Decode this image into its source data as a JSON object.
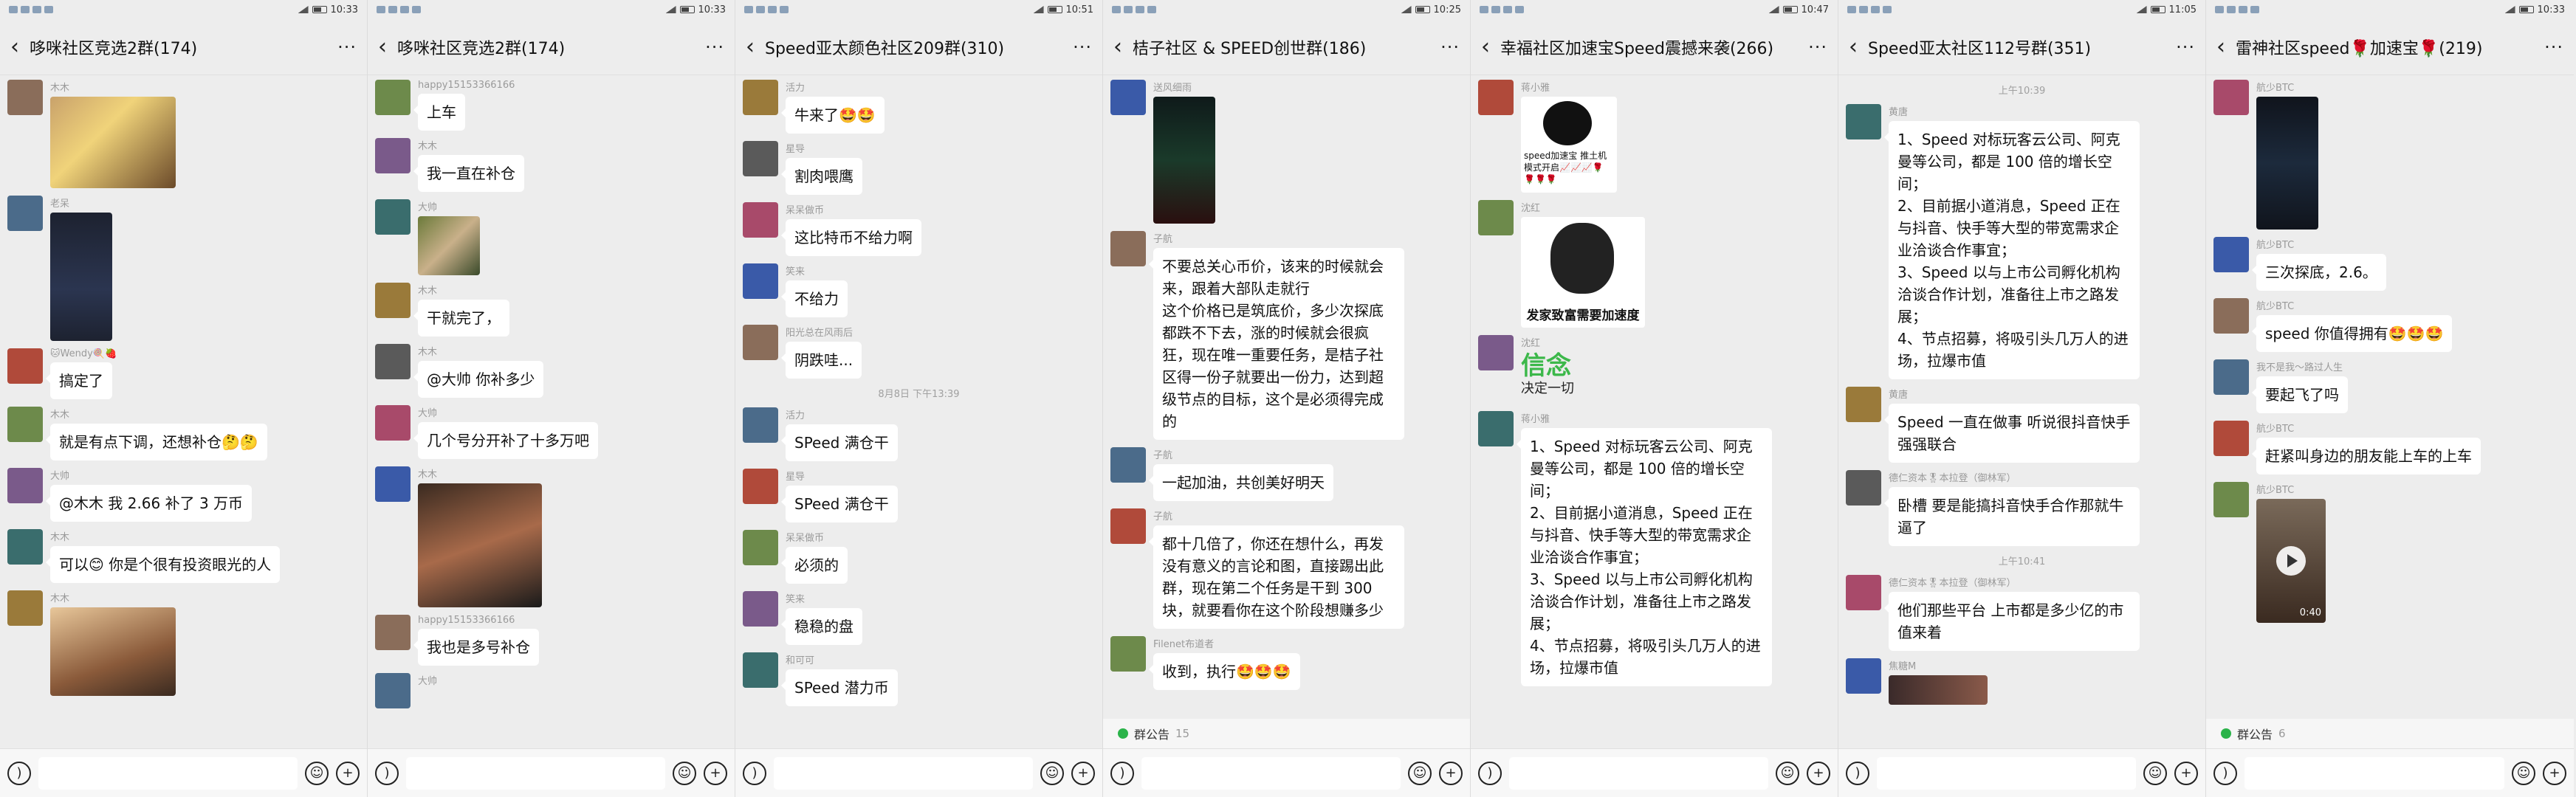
{
  "status": {
    "times": [
      "10:33",
      "10:33",
      "10:51",
      "10:25",
      "10:47",
      "11:05",
      "10:33"
    ]
  },
  "input": {
    "voice_icon": "voice-icon",
    "emoji_icon": "emoji-icon",
    "plus_icon": "plus-icon"
  },
  "colors": {
    "bg": "#ededed",
    "bubble": "#ffffff",
    "notice_dot": "#2bb34a"
  },
  "panels": [
    {
      "title": "哆咪社区竞选2群(174)",
      "messages": [
        {
          "sender": "木木",
          "image": "photo-child"
        },
        {
          "sender": "老呆",
          "image": "phone-screenshot"
        },
        {
          "sender": "🐱Wendy🍭🍓",
          "text": "搞定了"
        },
        {
          "sender": "木木",
          "text": "就是有点下调，还想补仓🤔🤔"
        },
        {
          "sender": "大帅",
          "text": "@木木  我 2.66 补了 3 万币"
        },
        {
          "sender": "木木",
          "text": "可以😊 你是个很有投资眼光的人"
        },
        {
          "sender": "木木",
          "image": "photo-man-smoking"
        }
      ]
    },
    {
      "title": "哆咪社区竞选2群(174)",
      "messages": [
        {
          "sender": "happy15153366166",
          "text": "上车"
        },
        {
          "sender": "木木",
          "text": "我一直在补仓"
        },
        {
          "sender": "大帅",
          "image": "photo-soldier"
        },
        {
          "sender": "木木",
          "text": "干就完了，"
        },
        {
          "sender": "木木",
          "text": "@大帅  你补多少"
        },
        {
          "sender": "大帅",
          "text": "几个号分开补了十多万吧"
        },
        {
          "sender": "木木",
          "image": "photo-woman"
        },
        {
          "sender": "happy15153366166",
          "text": "我也是多号补仓"
        },
        {
          "sender": "大帅",
          "text": ""
        }
      ]
    },
    {
      "title": "Speed亚太颜色社区209群(310)",
      "separator": "8月8日 下午13:39",
      "messages": [
        {
          "sender": "活力",
          "text": "牛来了🤩🤩"
        },
        {
          "sender": "星导",
          "text": "割肉喂鹰"
        },
        {
          "sender": "呆呆做币",
          "text": "这比特币不给力啊"
        },
        {
          "sender": "笑来",
          "text": "不给力"
        },
        {
          "sender": "阳光总在风雨后",
          "text": "阴跌哇..."
        },
        {
          "sender": "活力",
          "text": "SPeed 满仓干"
        },
        {
          "sender": "星导",
          "text": "SPeed 满仓干"
        },
        {
          "sender": "呆呆做币",
          "text": "必须的"
        },
        {
          "sender": "笑来",
          "text": "稳稳的盘"
        },
        {
          "sender": "和可可",
          "text": "SPeed 潜力币"
        }
      ]
    },
    {
      "title": "桔子社区 & SPEED创世群(186)",
      "notice": {
        "label": "群公告",
        "count": "15"
      },
      "messages": [
        {
          "sender": "送风细雨",
          "image": "chart-screenshot"
        },
        {
          "sender": "子航",
          "text": "不要总关心币价，该来的时候就会来，跟着大部队走就行\n这个价格已是筑底价，多少次探底都跌不下去，涨的时候就会很疯狂，现在唯一重要任务，是桔子社区得一份子就要出一份力，达到超级节点的目标，这个是必须得完成的"
        },
        {
          "sender": "子航",
          "text": "一起加油，共创美好明天"
        },
        {
          "sender": "子航",
          "text": "都十几倍了，你还在想什么，再发没有意义的言论和图，直接踢出此群，现在第二个任务是干到 300 块，就要看你在这个阶段想赚多少"
        },
        {
          "sender": "Filenet布道者",
          "text": "收到，执行🤩🤩🤩"
        }
      ]
    },
    {
      "title": "幸福社区加速宝Speed震撼来袭(266)",
      "messages": [
        {
          "sender": "蒋小雅",
          "image": "sticker-panda",
          "caption": "speed加速宝   推土机模式开启📈📈📈🌹🌹🌹🌹"
        },
        {
          "sender": "沈红",
          "image": "sticker-meme",
          "caption": "发家致富需要加速度"
        },
        {
          "sender": "沈红",
          "image": "sticker-xinnian",
          "caption": "信念",
          "caption2": "决定一切"
        },
        {
          "sender": "蒋小雅",
          "text": "1、Speed 对标玩客云公司、阿克曼等公司，都是 100 倍的增长空间；\n2、目前据小道消息，Speed 正在与抖音、快手等大型的带宽需求企业洽谈合作事宜；\n3、Speed 以与上市公司孵化机构洽谈合作计划，准备往上市之路发展；\n4、节点招募，将吸引头几万人的进场，拉爆市值"
        }
      ]
    },
    {
      "title": "Speed亚太社区112号群(351)",
      "separator": "上午10:39",
      "separator2": "上午10:41",
      "messages": [
        {
          "sender": "黄唐",
          "text": "1、Speed 对标玩客云公司、阿克曼等公司，都是 100 倍的增长空间；\n2、目前据小道消息，Speed 正在与抖音、快手等大型的带宽需求企业洽谈合作事宜；\n3、Speed 以与上市公司孵化机构洽谈合作计划，准备往上市之路发展；\n4、节点招募，将吸引头几万人的进场，拉爆市值"
        },
        {
          "sender": "黄唐",
          "text": "Speed 一直在做事  听说很抖音快手强强联合"
        },
        {
          "sender": "德仁资本🎖本拉登（御林军）",
          "text": "卧槽 要是能搞抖音快手合作那就牛逼了"
        },
        {
          "sender": "德仁资本🎖本拉登（御林军）",
          "text": "他们那些平台 上市都是多少亿的市值来着"
        },
        {
          "sender": "焦糖M",
          "image": "photo-partial"
        }
      ]
    },
    {
      "title": "雷神社区speed🌹加速宝🌹(219)",
      "notice": {
        "label": "群公告",
        "count": "6"
      },
      "messages": [
        {
          "sender": "航少BTC",
          "image": "chart-dark"
        },
        {
          "sender": "航少BTC",
          "text": "三次探底，2.6。"
        },
        {
          "sender": "航少BTC",
          "text": "speed 你值得拥有🤩🤩🤩"
        },
        {
          "sender": "我不是我～路过人生",
          "text": "要起飞了吗"
        },
        {
          "sender": "航少BTC",
          "text": "赶紧叫身边的朋友能上车的上车"
        },
        {
          "sender": "航少BTC",
          "image": "video",
          "caption": "0:40"
        }
      ]
    }
  ]
}
